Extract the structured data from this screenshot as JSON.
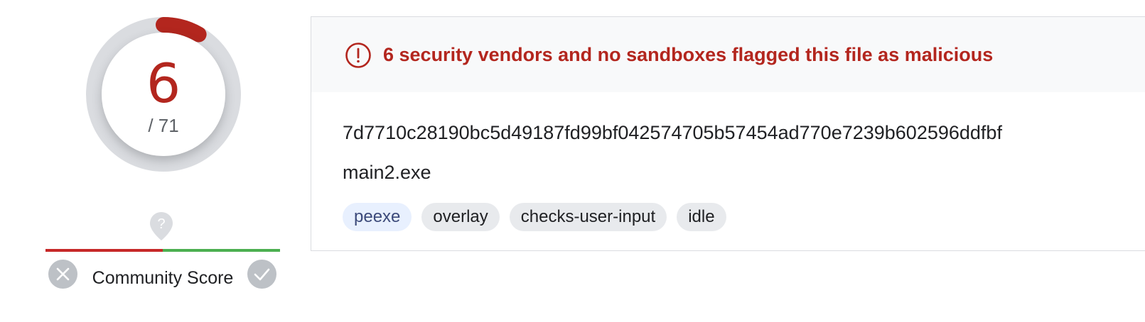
{
  "detection": {
    "positives": "6",
    "total": "/ 71",
    "ring_fraction": 0.0845,
    "colors": {
      "malicious": "#b3261e",
      "ring_track": "#dadce0"
    }
  },
  "community": {
    "label": "Community Score",
    "help_icon": "question-pin-icon",
    "help_glyph": "?",
    "vote_down_icon": "close-icon",
    "vote_up_icon": "check-icon",
    "negative_share": 0.5,
    "colors": {
      "negative": "#c62828",
      "positive": "#4caf50"
    }
  },
  "summary": {
    "alert_icon": "exclamation-circle-icon",
    "alert_text": "6 security vendors and no sandboxes flagged this file as malicious",
    "file_hash": "7d7710c28190bc5d49187fd99bf042574705b57454ad770e7239b602596ddfbf",
    "file_name": "main2.exe",
    "tags": [
      {
        "label": "peexe"
      },
      {
        "label": "overlay"
      },
      {
        "label": "checks-user-input"
      },
      {
        "label": "idle"
      }
    ]
  }
}
